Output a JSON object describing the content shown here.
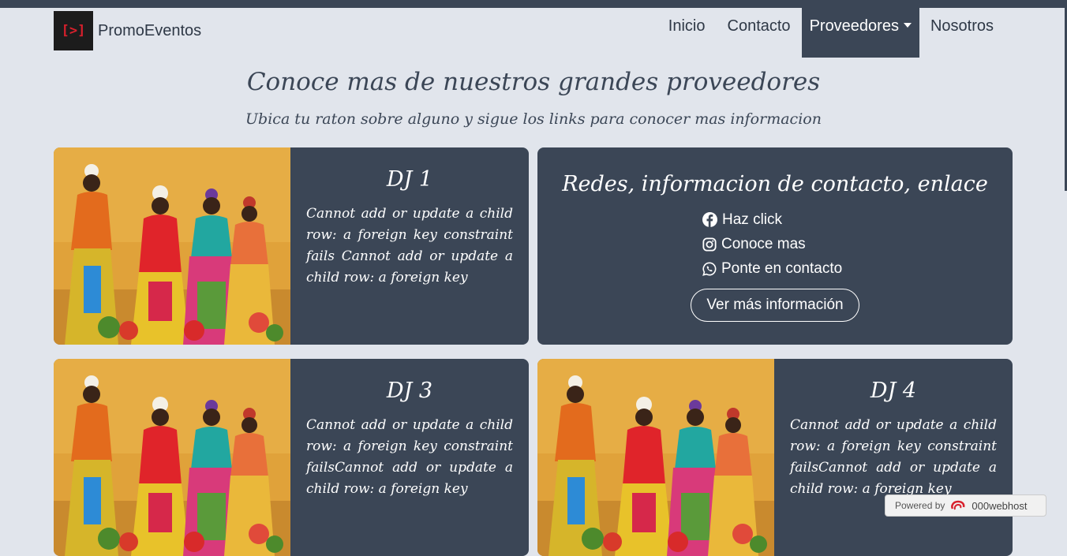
{
  "nav": {
    "brand_logo": "[>]",
    "brand_name": "PromoEventos",
    "items": [
      {
        "label": "Inicio"
      },
      {
        "label": "Contacto"
      },
      {
        "label": "Proveedores"
      },
      {
        "label": "Nosotros"
      }
    ],
    "active_item": "Proveedores"
  },
  "header": {
    "title": "Conoce mas de nuestros grandes proveedores",
    "subtitle": "Ubica tu raton sobre alguno y sigue los links para conocer mas informacion"
  },
  "cards": [
    {
      "title": "DJ 1",
      "text": "Cannot add or update a child row: a foreign key constraint fails Cannot add or update a child row: a foreign key"
    },
    {
      "title": "DJ 3",
      "text": "Cannot add or update a child row: a foreign key constraint failsCannot add or update a child row: a foreign key"
    },
    {
      "title": "DJ 4",
      "text": "Cannot add or update a child row: a foreign key constraint failsCannot add or update a child row: a foreign key"
    }
  ],
  "contact_card": {
    "heading": "Redes, informacion de contacto, enlace",
    "links": [
      {
        "icon": "facebook-icon",
        "label": "Haz click"
      },
      {
        "icon": "instagram-icon",
        "label": "Conoce mas"
      },
      {
        "icon": "whatsapp-icon",
        "label": "Ponte en contacto"
      }
    ],
    "button_label": "Ver más información"
  },
  "footer_badge": {
    "powered_by": "Powered by",
    "host": "000webhost"
  },
  "colors": {
    "background": "#e1e5ec",
    "card": "#3b4656",
    "accent_logo": "#d8202c"
  }
}
